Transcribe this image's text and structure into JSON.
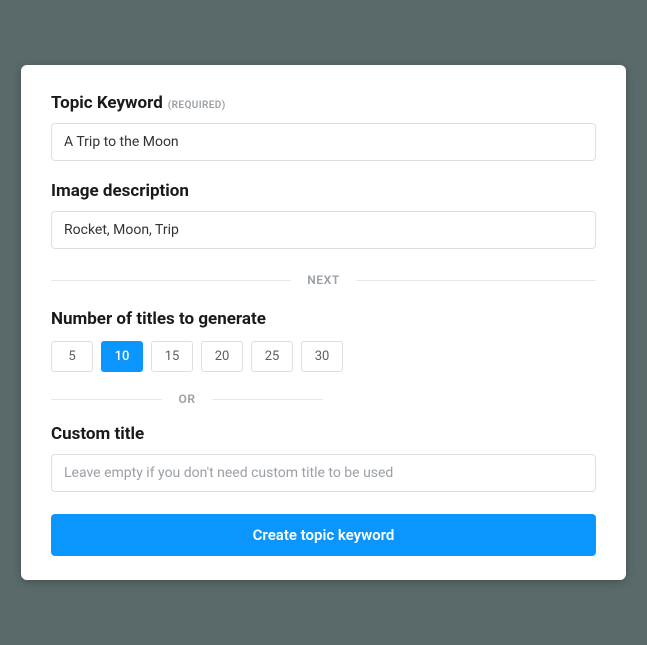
{
  "topicKeyword": {
    "label": "Topic Keyword",
    "requiredTag": "(REQUIRED)",
    "value": "A Trip to the Moon"
  },
  "imageDescription": {
    "label": "Image description",
    "value": "Rocket, Moon, Trip"
  },
  "dividerNext": "NEXT",
  "numberOfTitles": {
    "label": "Number of titles to generate",
    "options": [
      "5",
      "10",
      "15",
      "20",
      "25",
      "30"
    ],
    "selected": "10"
  },
  "dividerOr": "OR",
  "customTitle": {
    "label": "Custom title",
    "placeholder": "Leave empty if you don't need custom title to be used",
    "value": ""
  },
  "submitLabel": "Create topic keyword"
}
